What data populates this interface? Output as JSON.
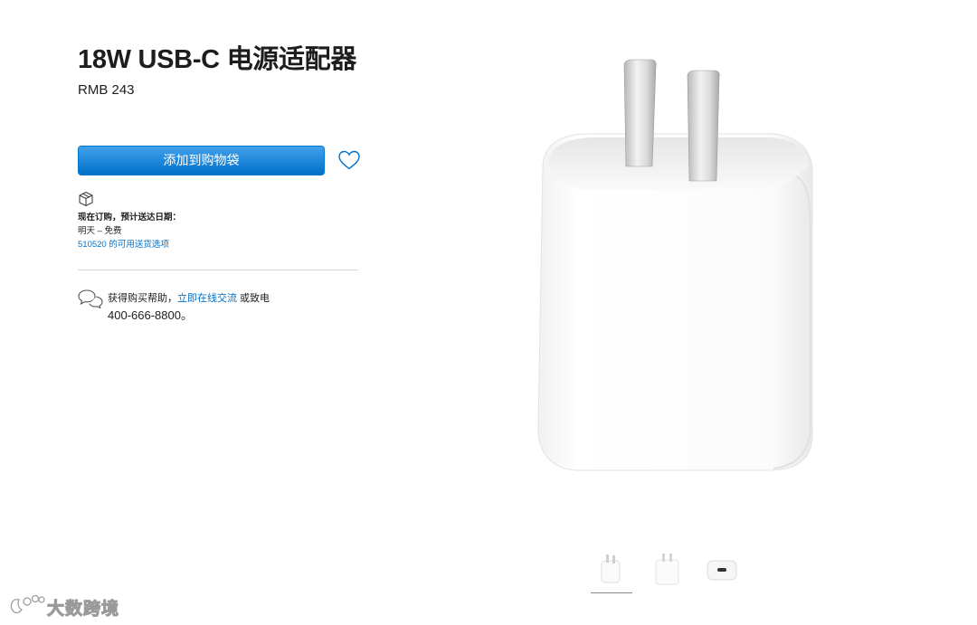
{
  "product": {
    "title": "18W USB-C 电源适配器",
    "price": "RMB 243"
  },
  "buy": {
    "add_to_bag_label": "添加到购物袋",
    "favorite_icon": "heart-icon"
  },
  "delivery": {
    "icon": "box-icon",
    "heading": "现在订购，预计送达日期：",
    "estimate": "明天 – 免费",
    "options_link": "510520 的可用送货选项"
  },
  "help": {
    "icon": "chat-bubbles-icon",
    "prefix": "获得购买帮助，",
    "chat_link": "立即在线交流",
    "suffix": " 或致电",
    "phone": "400-666-8800。"
  },
  "gallery": {
    "main_image": "usb-c-power-adapter-image",
    "thumbnails": [
      "adapter-front-thumbnail",
      "adapter-side-thumbnail",
      "adapter-port-thumbnail"
    ],
    "selected_index": 0
  },
  "watermark": {
    "text": "大数跨境"
  },
  "colors": {
    "accent": "#0070c9",
    "button_top": "#42a1ec",
    "button_bottom": "#0070c9"
  }
}
